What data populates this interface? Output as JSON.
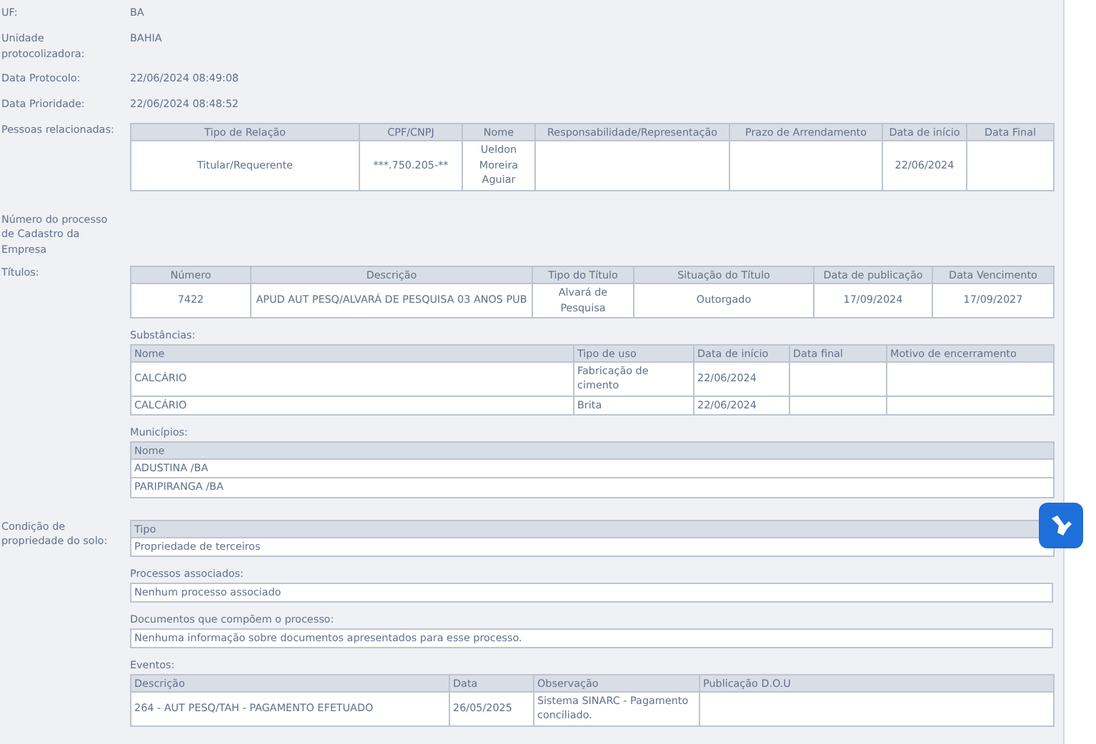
{
  "sections": [
    {
      "kind": "field",
      "label": "UF:",
      "value": "BA"
    },
    {
      "kind": "field",
      "label": "Unidade protocolizadora:",
      "value": "BAHIA"
    },
    {
      "kind": "field",
      "label": "Data Protocolo:",
      "value": "22/06/2024 08:49:08"
    },
    {
      "kind": "field",
      "label": "Data Prioridade:",
      "value": "22/06/2024 08:48:52"
    },
    {
      "kind": "tables",
      "label": "Pessoas relacionadas:",
      "blocks": [
        {
          "kind": "grid",
          "columns": [
            "Tipo de Relação",
            "CPF/CNPJ",
            "Nome",
            "Responsabilidade/Representação",
            "Prazo de Arrendamento",
            "Data de início",
            "Data Final"
          ],
          "rows": [
            [
              "Titular/Requerente",
              "***.750.205-**",
              "Ueldon Moreira Aguiar",
              null,
              null,
              "22/06/2024",
              null
            ]
          ]
        }
      ]
    },
    {
      "kind": "blank",
      "label": "Número do processo de Cadastro da Empresa"
    },
    {
      "kind": "tables",
      "label": "Títulos:",
      "blocks": [
        {
          "kind": "grid",
          "columns": [
            "Número",
            "Descrição",
            "Tipo do Título",
            "Situação do Título",
            "Data de publicação",
            "Data Vencimento"
          ],
          "rows": [
            [
              "7422",
              "APUD AUT PESQ/ALVARÁ DE PESQUISA 03 ANOS PUB",
              "Alvará de Pesquisa",
              "Outorgado",
              "17/09/2024",
              "17/09/2027"
            ]
          ]
        },
        {
          "kind": "list",
          "caption": "Substâncias:",
          "columns": [
            "Nome",
            "Tipo de uso",
            "Data de início",
            "Data final",
            "Motivo de encerramento"
          ],
          "rows": [
            [
              "CALCÁRIO",
              "Fabricação de cimento",
              "22/06/2024",
              null,
              null
            ],
            [
              "CALCÁRIO",
              "Brita",
              "22/06/2024",
              null,
              null
            ]
          ]
        },
        {
          "kind": "list",
          "caption": "Municípios:",
          "columns": [
            "Nome"
          ],
          "rows": [
            [
              "ADUSTINA /BA"
            ],
            [
              "PARIPIRANGA /BA"
            ]
          ]
        }
      ]
    },
    {
      "kind": "tables",
      "label": "Condição de propriedade do solo:",
      "blocks": [
        {
          "kind": "list",
          "columns": [
            "Tipo"
          ],
          "rows": [
            [
              "Propriedade de terceiros"
            ]
          ]
        },
        {
          "kind": "note",
          "caption": "Processos associados:",
          "text": "Nenhum processo associado"
        },
        {
          "kind": "note",
          "caption": "Documentos que compõem o processo:",
          "text": "Nenhuma informação sobre documentos apresentados para esse processo."
        },
        {
          "kind": "list",
          "caption": "Eventos:",
          "columns": [
            "Descrição",
            "Data",
            "Observação",
            "Publicação D.O.U"
          ],
          "rows": [
            [
              "264 - AUT PESQ/TAH - PAGAMENTO EFETUADO",
              "26/05/2025",
              "Sistema SINARC - Pagamento conciliado.",
              null
            ]
          ]
        }
      ]
    }
  ]
}
